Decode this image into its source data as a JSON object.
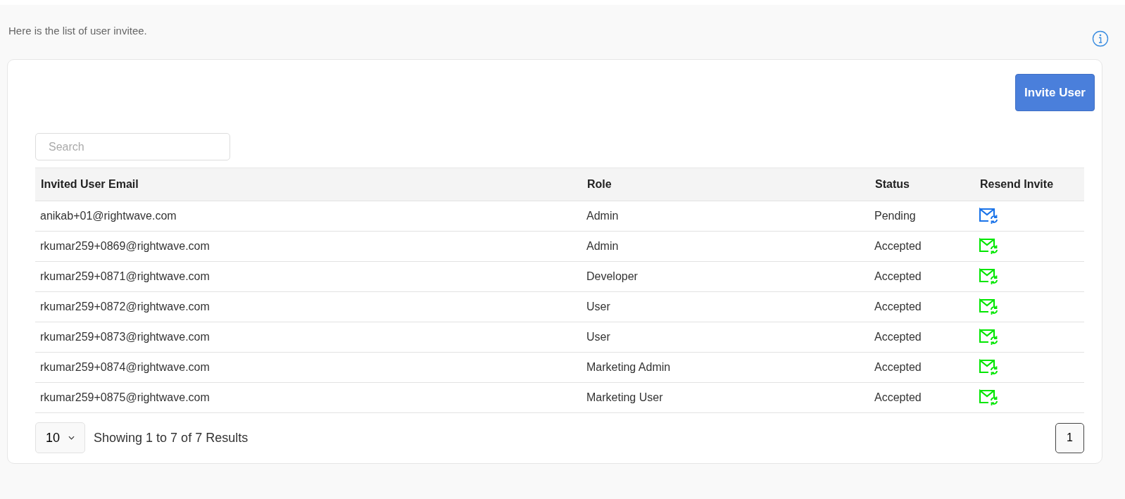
{
  "intro": "Here is the list of user invitee.",
  "invite_button": "Invite User",
  "search": {
    "placeholder": "Search"
  },
  "table": {
    "columns": [
      "Invited User Email",
      "Role",
      "Status",
      "Resend Invite"
    ],
    "rows": [
      {
        "email": "anikab+01@rightwave.com",
        "role": "Admin",
        "status": "Pending",
        "color": "#1a73e8"
      },
      {
        "email": "rkumar259+0869@rightwave.com",
        "role": "Admin",
        "status": "Accepted",
        "color": "#00e600"
      },
      {
        "email": "rkumar259+0871@rightwave.com",
        "role": "Developer",
        "status": "Accepted",
        "color": "#00e600"
      },
      {
        "email": "rkumar259+0872@rightwave.com",
        "role": "User",
        "status": "Accepted",
        "color": "#00e600"
      },
      {
        "email": "rkumar259+0873@rightwave.com",
        "role": "User",
        "status": "Accepted",
        "color": "#00e600"
      },
      {
        "email": "rkumar259+0874@rightwave.com",
        "role": "Marketing Admin",
        "status": "Accepted",
        "color": "#00e600"
      },
      {
        "email": "rkumar259+0875@rightwave.com",
        "role": "Marketing User",
        "status": "Accepted",
        "color": "#00e600"
      }
    ]
  },
  "page_size": "10",
  "summary": "Showing 1 to 7 of 7 Results",
  "pages": [
    {
      "label": "1",
      "selected": true
    }
  ]
}
